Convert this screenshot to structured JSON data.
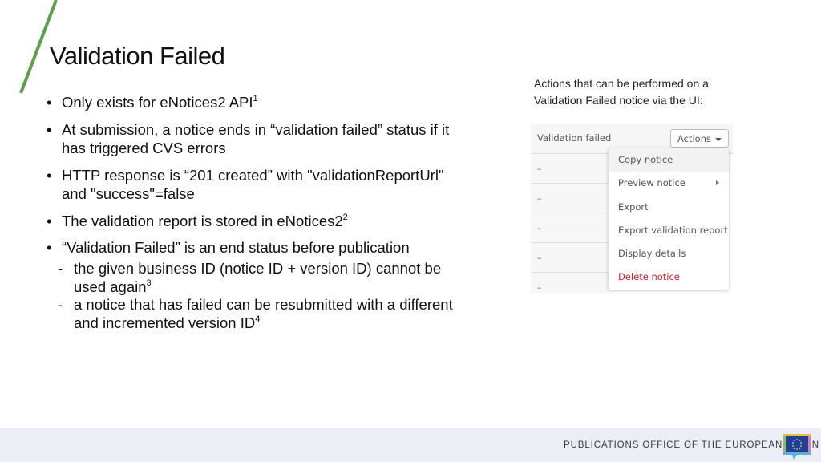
{
  "slide": {
    "title": "Validation Failed",
    "bullets": [
      {
        "text": "Only exists for eNotices2 API",
        "sup": "1"
      },
      {
        "text": "At submission, a notice ends in “validation failed” status if it has triggered CVS errors",
        "sup": ""
      },
      {
        "text": "HTTP response is “201 created” with \"validationReportUrl\" and \"success\"=false",
        "sup": ""
      },
      {
        "text": "The validation report is stored in eNotices2",
        "sup": "2"
      },
      {
        "text": "“Validation Failed” is an end status before publication",
        "sup": ""
      }
    ],
    "sub_bullets": [
      {
        "text": "the given business ID (notice ID + version ID) cannot be used again",
        "sup": "3"
      },
      {
        "text": "a notice that has failed can be resubmitted with a different and incremented version ID",
        "sup": "4"
      }
    ],
    "bullet_glyph": "•",
    "dash_glyph": "-",
    "caption": "Actions that can be performed on a Validation Failed notice via the UI:"
  },
  "ui_screenshot": {
    "column_header": "Validation failed",
    "actions_button": "Actions",
    "rows": [
      "–",
      "–",
      "–",
      "–",
      "–"
    ],
    "menu_items": [
      {
        "label": "Copy notice",
        "state": "hover"
      },
      {
        "label": "Preview notice",
        "has_submenu": true
      },
      {
        "label": "Export"
      },
      {
        "label": "Export validation report"
      },
      {
        "label": "Display details"
      },
      {
        "label": "Delete notice",
        "style": "danger"
      }
    ],
    "danger_color": "#cc2229"
  },
  "footer": {
    "organization": "PUBLICATIONS OFFICE OF THE EUROPEAN UNION",
    "logo": "eu-flag-speech-bubble-icon"
  },
  "colors": {
    "accent_line": "#5aa04a",
    "footer_bg": "#ebeef4"
  }
}
